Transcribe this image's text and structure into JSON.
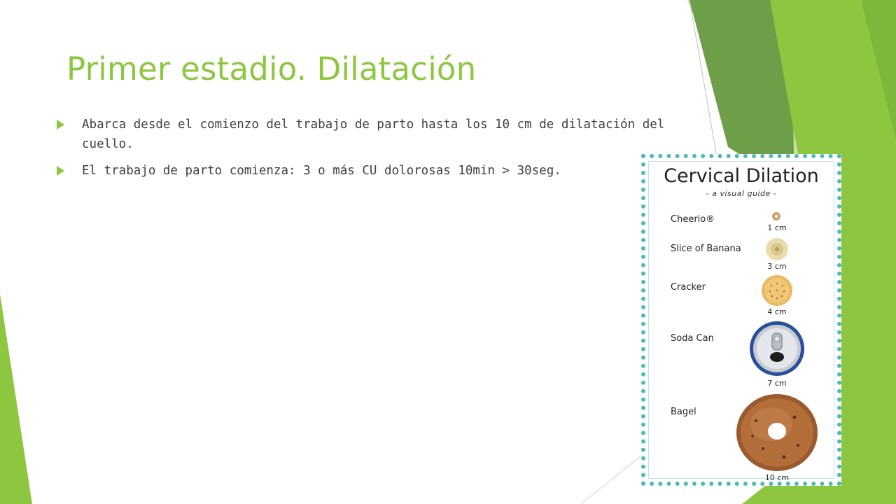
{
  "slide": {
    "title": "Primer estadio. Dilatación",
    "bullets": [
      "Abarca desde el comienzo del trabajo de parto hasta los 10 cm de dilatación del cuello.",
      "El trabajo de parto comienza: 3 o más CU dolorosas 10min > 30seg."
    ]
  },
  "guide": {
    "title": "Cervical Dilation",
    "subtitle": "- a visual guide -",
    "items": [
      {
        "label": "Cheerio®",
        "size": "1 cm",
        "icon": "cheerio-icon"
      },
      {
        "label": "Slice of Banana",
        "size": "3 cm",
        "icon": "banana-slice-icon"
      },
      {
        "label": "Cracker",
        "size": "4 cm",
        "icon": "cracker-icon"
      },
      {
        "label": "Soda Can",
        "size": "7 cm",
        "icon": "soda-can-icon"
      },
      {
        "label": "Bagel",
        "size": "10 cm",
        "icon": "bagel-icon"
      }
    ]
  },
  "colors": {
    "accent": "#8dc63f",
    "border": "#4fb9b5",
    "text": "#404040"
  }
}
